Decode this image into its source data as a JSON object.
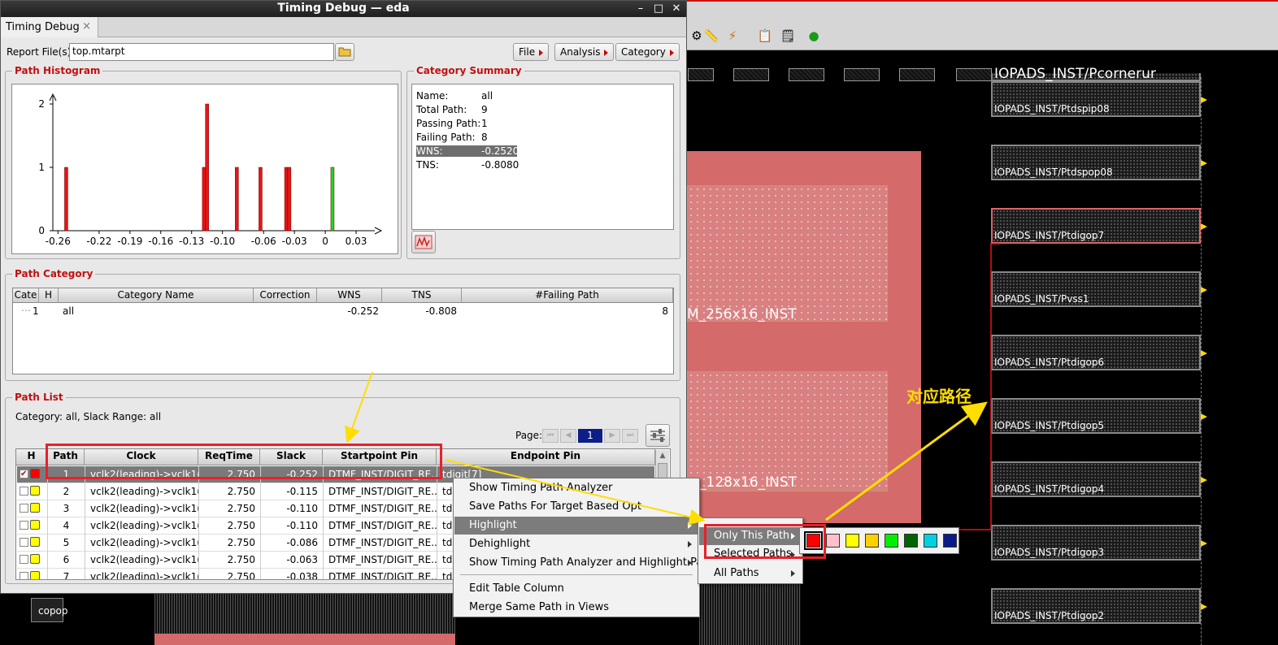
{
  "window": {
    "title": "Timing Debug — eda",
    "min": "–",
    "max": "□",
    "close": "✕"
  },
  "tab": {
    "label": "Timing Debug",
    "close": "×"
  },
  "report": {
    "label": "Report File(s)",
    "value": "top.mtarpt",
    "folder_icon": "folder-open-icon"
  },
  "menus": {
    "file": "File",
    "analysis": "Analysis",
    "category": "Category"
  },
  "histogram": {
    "title": "Path Histogram",
    "chart_data": {
      "type": "bar",
      "x_ticks": [
        "-0.26",
        "-0.22",
        "-0.19",
        "-0.16",
        "-0.13",
        "-0.10",
        "-0.06",
        "-0.03",
        "0",
        "0.03"
      ],
      "y_ticks": [
        "0",
        "1",
        "2"
      ],
      "xlim": [
        -0.265,
        0.045
      ],
      "ylim": [
        0,
        2
      ],
      "bars": [
        {
          "x": -0.252,
          "value": 1,
          "status": "failing"
        },
        {
          "x": -0.118,
          "value": 1,
          "status": "failing"
        },
        {
          "x": -0.115,
          "value": 2,
          "status": "failing"
        },
        {
          "x": -0.086,
          "value": 1,
          "status": "failing"
        },
        {
          "x": -0.063,
          "value": 1,
          "status": "failing"
        },
        {
          "x": -0.038,
          "value": 1,
          "status": "failing"
        },
        {
          "x": -0.035,
          "value": 1,
          "status": "failing"
        },
        {
          "x": 0.007,
          "value": 1,
          "status": "passing"
        }
      ],
      "colors": {
        "failing": "#e81515",
        "passing": "#22d322"
      }
    }
  },
  "summary": {
    "title": "Category Summary",
    "rows": [
      {
        "key": "Name:",
        "value": "all"
      },
      {
        "key": "Total Path:",
        "value": "9"
      },
      {
        "key": "Passing Path:",
        "value": "1"
      },
      {
        "key": "Failing Path:",
        "value": "8"
      },
      {
        "key": "WNS:",
        "value": "-0.2520"
      },
      {
        "key": "TNS:",
        "value": "-0.8080"
      }
    ],
    "histogram_button_icon": "histogram-icon"
  },
  "category": {
    "title": "Path Category",
    "headers": [
      "Cate",
      "H",
      "Category Name",
      "Correction",
      "WNS",
      "TNS",
      "#Failing Path"
    ],
    "row": {
      "id": "1",
      "name": "all",
      "wns": "-0.252",
      "tns": "-0.808",
      "failing": "8"
    }
  },
  "pathlist": {
    "title": "Path List",
    "filter": "Category: all,   Slack Range: all",
    "page_label": "Page:",
    "page": "1",
    "headers": [
      "H",
      "Path",
      "Clock",
      "ReqTime",
      "Slack",
      "Startpoint Pin",
      "Endpoint Pin"
    ],
    "rows": [
      {
        "path": "1",
        "clock": "vclk2(leading)->vclk1(...",
        "req": "2.750",
        "slack": "-0.252",
        "start": "DTMF_INST/DIGIT_RE...",
        "end": "tdigit[7]",
        "color": "#ff0000",
        "checked": true
      },
      {
        "path": "2",
        "clock": "vclk2(leading)->vclk1(...",
        "req": "2.750",
        "slack": "-0.115",
        "start": "DTMF_INST/DIGIT_RE...",
        "end": "tdi",
        "color": "#ffff00",
        "checked": false
      },
      {
        "path": "3",
        "clock": "vclk2(leading)->vclk1(...",
        "req": "2.750",
        "slack": "-0.110",
        "start": "DTMF_INST/DIGIT_RE...",
        "end": "tdi",
        "color": "#ffff00",
        "checked": false
      },
      {
        "path": "4",
        "clock": "vclk2(leading)->vclk1(...",
        "req": "2.750",
        "slack": "-0.110",
        "start": "DTMF_INST/DIGIT_RE...",
        "end": "tdi",
        "color": "#ffff00",
        "checked": false
      },
      {
        "path": "5",
        "clock": "vclk2(leading)->vclk1(...",
        "req": "2.750",
        "slack": "-0.086",
        "start": "DTMF_INST/DIGIT_RE...",
        "end": "tdi",
        "color": "#ffff00",
        "checked": false
      },
      {
        "path": "6",
        "clock": "vclk2(leading)->vclk1(...",
        "req": "2.750",
        "slack": "-0.063",
        "start": "DTMF_INST/DIGIT_RE...",
        "end": "tdi",
        "color": "#ffff00",
        "checked": false
      },
      {
        "path": "7",
        "clock": "vclk2(leading)->vclk1(...",
        "req": "2.750",
        "slack": "-0.038",
        "start": "DTMF_INST/DIGIT_RE...",
        "end": "tdi",
        "color": "#ffff00",
        "checked": false
      }
    ]
  },
  "context_menu": {
    "items": [
      "Show Timing Path Analyzer",
      "Save Paths For Target Based Opt",
      "Highlight",
      "Dehighlight",
      "Show Timing Path Analyzer and Highlight Path",
      "Edit Table Column",
      "Merge Same Path in Views"
    ]
  },
  "submenu": {
    "items": [
      "Only This Path",
      "Selected Paths",
      "All Paths"
    ]
  },
  "swatches": [
    "#ff0000",
    "#ffc0cb",
    "#ffff00",
    "#ffd000",
    "#00ee00",
    "#006400",
    "#00d0e0",
    "#0a1a8a"
  ],
  "layout_view": {
    "pads": [
      "IOPADS_INST/Pcornerur",
      "IOPADS_INST/Ptdspip08",
      "IOPADS_INST/Ptdspop08",
      "IOPADS_INST/Ptdigop7",
      "IOPADS_INST/Pvss1",
      "IOPADS_INST/Ptdigop6",
      "IOPADS_INST/Ptdigop5",
      "IOPADS_INST/Ptdigop4",
      "IOPADS_INST/Ptdigop3",
      "IOPADS_INST/Ptdigop2"
    ],
    "mem1": "M_256x16_INST",
    "mem2": "_128x16_INST",
    "copop": "copop",
    "annotation": "对应路径"
  },
  "colors": {
    "accent_title": "#c01010",
    "highlight_red": "#e8202a",
    "arrow_yellow": "#ffde00"
  }
}
